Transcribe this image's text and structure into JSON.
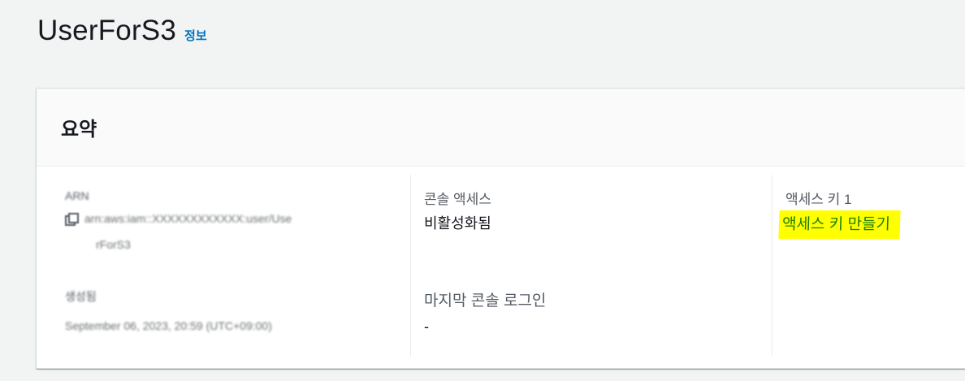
{
  "header": {
    "title": "UserForS3",
    "info_link": "정보"
  },
  "summary": {
    "title": "요약",
    "arn": {
      "label": "ARN",
      "value_line1": "arn:aws:iam::XXXXXXXXXXXX:user/Use",
      "value_line2": "rForS3"
    },
    "created": {
      "label": "생성됨",
      "value": "September 06, 2023, 20:59 (UTC+09:00)"
    },
    "console_access": {
      "label": "콘솔 액세스",
      "value": "비활성화됨"
    },
    "last_console_login": {
      "label": "마지막 콘솔 로그인",
      "value": "-"
    },
    "access_key": {
      "label": "액세스 키 1",
      "create_link": "액세스 키 만들기",
      "highlight_color": "#ffff00",
      "link_color": "#1d8102"
    }
  },
  "icons": {
    "copy": "copy-icon"
  }
}
